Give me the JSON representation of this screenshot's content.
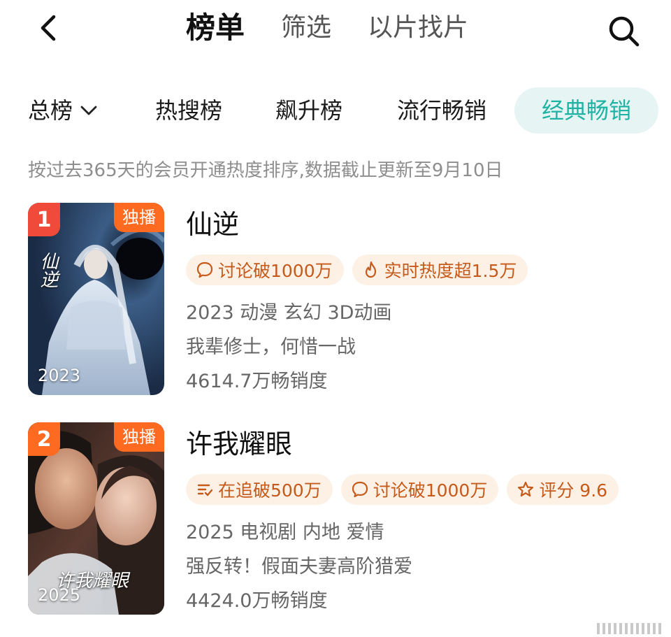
{
  "header": {
    "tabs": [
      {
        "label": "榜单"
      },
      {
        "label": "筛选"
      },
      {
        "label": "以片找片"
      }
    ]
  },
  "subtabs": {
    "dropdown_label": "总榜",
    "items": [
      {
        "label": "热搜榜"
      },
      {
        "label": "飙升榜"
      },
      {
        "label": "流行畅销"
      },
      {
        "label": "经典畅销"
      }
    ]
  },
  "description": "按过去365天的会员开通热度排序,数据截止更新至9月10日",
  "items": [
    {
      "rank": "1",
      "badge": "独播",
      "poster_year": "2023",
      "poster_title": "仙逆",
      "title": "仙逆",
      "chips": [
        {
          "icon": "comment-icon",
          "label": "讨论破1000万"
        },
        {
          "icon": "flame-icon",
          "label": "实时热度超1.5万"
        }
      ],
      "meta": "2023 动漫 玄幻 3D动画",
      "tagline": "我辈修士，何惜一战",
      "sales": "4614.7万畅销度"
    },
    {
      "rank": "2",
      "badge": "独播",
      "poster_year": "2025",
      "poster_title": "许我耀眼",
      "title": "许我耀眼",
      "chips": [
        {
          "icon": "follow-list-icon",
          "label": "在追破500万"
        },
        {
          "icon": "comment-icon",
          "label": "讨论破1000万"
        },
        {
          "icon": "star-icon",
          "label": "评分 9.6"
        }
      ],
      "meta": "2025 电视剧 内地 爱情",
      "tagline": "强反转！假面夫妻高阶猎爱",
      "sales": "4424.0万畅销度"
    }
  ],
  "colors": {
    "accent": "#1fb3a4",
    "accent_bg": "#e6f5f4",
    "rank_badge": "#f04b3a",
    "exclusive_badge": "#ff6a21",
    "chip_bg": "#fdf1e6",
    "chip_text": "#c55a1a"
  }
}
